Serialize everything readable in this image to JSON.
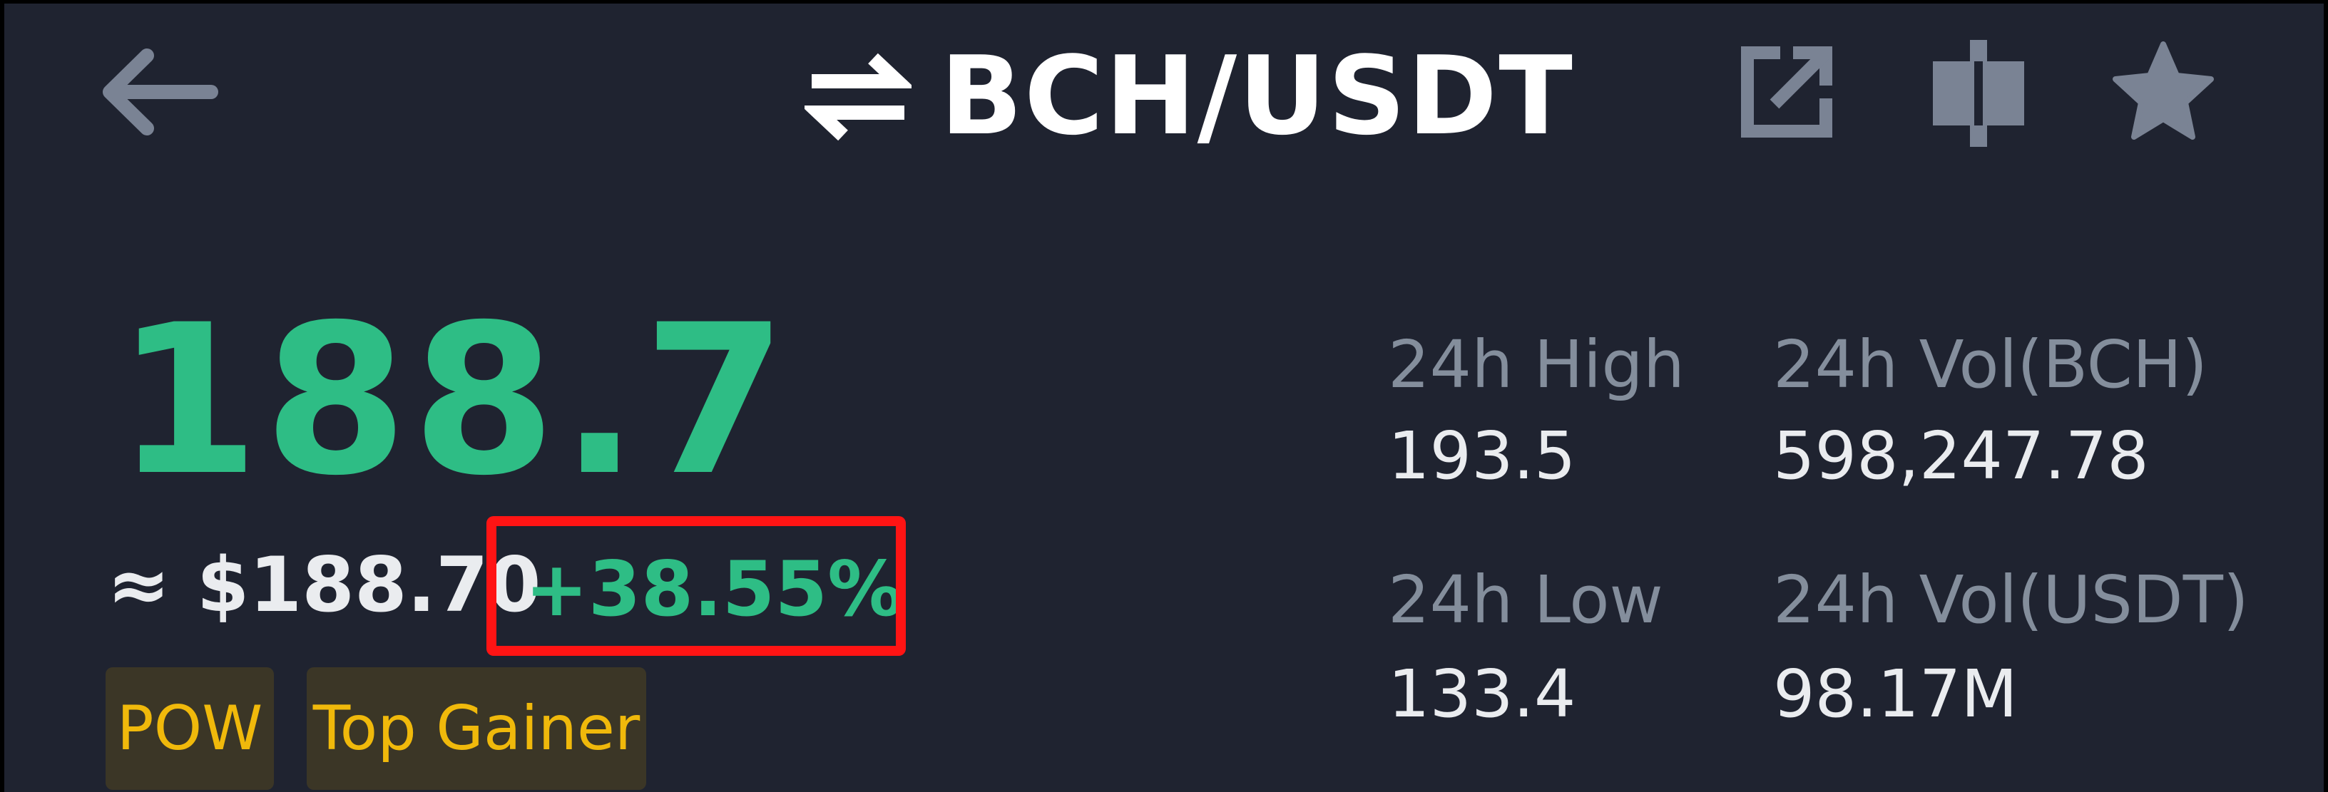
{
  "header": {
    "pair": "BCH/USDT",
    "icons": {
      "back": "arrow-left-icon",
      "swap": "swap-arrows-icon",
      "share": "share-icon",
      "chart": "candlestick-icon",
      "favorite": "star-icon"
    }
  },
  "price": {
    "last": "188.7",
    "fiat": "≈ $188.70",
    "change": "+38.55%"
  },
  "tags": [
    "POW",
    "Top Gainer"
  ],
  "stats": {
    "high_label": "24h High",
    "high_value": "193.5",
    "low_label": "24h Low",
    "low_value": "133.4",
    "vol_base_label": "24h Vol(BCH)",
    "vol_base_value": "598,247.78",
    "vol_quote_label": "24h Vol(USDT)",
    "vol_quote_value": "98.17M"
  },
  "colors": {
    "background": "#1f2330",
    "up": "#2ebd85",
    "tag_text": "#f0b90b",
    "tag_bg": "#3b3626",
    "muted": "#848e9c",
    "highlight": "#ff1414"
  }
}
